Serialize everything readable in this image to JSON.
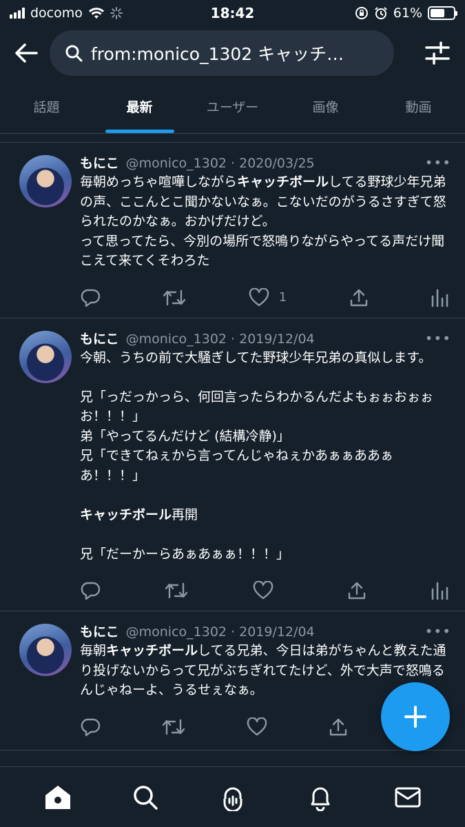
{
  "status": {
    "carrier": "docomo",
    "time": "18:42",
    "battery": "61%",
    "battery_level": 0.61
  },
  "search": {
    "query": "from:monico_1302 キャッチ…"
  },
  "tabs": [
    {
      "label": "話題"
    },
    {
      "label": "最新"
    },
    {
      "label": "ユーザー"
    },
    {
      "label": "画像"
    },
    {
      "label": "動画"
    }
  ],
  "tweets": [
    {
      "name": "もにこ",
      "meta": "@monico_1302 · 2020/03/25",
      "text_before": "毎朝めっちゃ喧嘩しながら",
      "highlight": "キャッチボール",
      "text_after": "してる野球少年兄弟の声、ここんとこ聞かないなぁ。こないだのがうるさすぎて怒られたのかなぁ。おかげだけど。\nって思ってたら、今別の場所で怒鳴りながらやってる声だけ聞こえて来てくそわろた",
      "likes": "1"
    },
    {
      "name": "もにこ",
      "meta": "@monico_1302 · 2019/12/04",
      "text_before": "今朝、うちの前で大騒ぎしてた野球少年兄弟の真似します。\n\n兄「っだっかっら、何回言ったらわかるんだよもぉぉおぉぉお！！！」\n弟「やってるんだけど (結構冷静)」\n兄「できてねぇから言ってんじゃねぇかあぁぁああぁあ！！！」\n\n",
      "highlight": "キャッチボール",
      "text_after": "再開\n\n兄「だーかーらあぁあぁぁ！！！」",
      "likes": ""
    },
    {
      "name": "もにこ",
      "meta": "@monico_1302 · 2019/12/04",
      "text_before": "毎朝",
      "highlight": "キャッチボール",
      "text_after": "してる兄弟、今日は弟がちゃんと教えた通り投げないからって兄がぶちぎれてたけど、外で大声で怒鳴るんじゃねーよ、うるせぇなぁ。",
      "likes": ""
    }
  ],
  "more_glyph": "•••",
  "icons": [
    "signal-icon",
    "wifi-icon",
    "spinner-icon",
    "lock-rotation-icon",
    "alarm-icon",
    "battery-icon",
    "back-arrow-icon",
    "search-icon",
    "filter-icon",
    "reply-icon",
    "retweet-icon",
    "like-icon",
    "share-icon",
    "analytics-icon",
    "compose-plus-icon",
    "home-icon",
    "explore-icon",
    "spaces-icon",
    "notifications-icon",
    "messages-icon"
  ],
  "colors": {
    "background": "#15202b",
    "accent": "#1d9bf0",
    "secondary_text": "#8b98a5",
    "divider": "#38444d",
    "search_bg": "#273340"
  }
}
